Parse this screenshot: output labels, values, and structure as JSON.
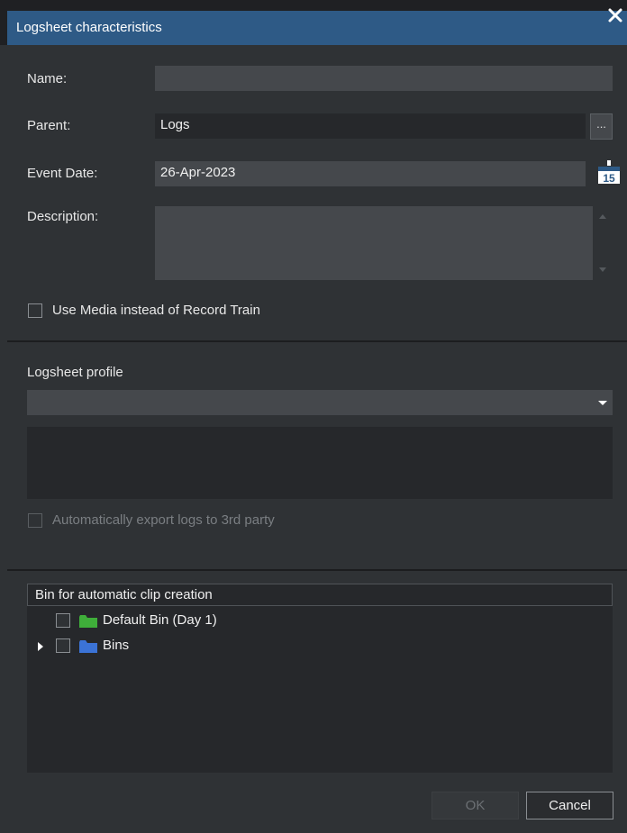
{
  "window": {
    "title": "Logsheet characteristics"
  },
  "form": {
    "name_label": "Name:",
    "name_value": "",
    "parent_label": "Parent:",
    "parent_value": "Logs",
    "browse_label": "...",
    "event_date_label": "Event Date:",
    "event_date_value": "26-Apr-2023",
    "calendar_day": "15",
    "description_label": "Description:",
    "description_value": "",
    "use_media_label": "Use Media instead of Record Train",
    "use_media_checked": false
  },
  "profile": {
    "section_label": "Logsheet profile",
    "selected": "",
    "auto_export_label": "Automatically export logs to 3rd party",
    "auto_export_checked": false,
    "auto_export_enabled": false
  },
  "bins": {
    "header": "Bin for automatic clip creation",
    "items": [
      {
        "label": "Default Bin (Day 1)",
        "checked": false,
        "folder_color": "#3fae3a",
        "expandable": false
      },
      {
        "label": "Bins",
        "checked": false,
        "folder_color": "#3b73d6",
        "expandable": true
      }
    ]
  },
  "buttons": {
    "ok": "OK",
    "cancel": "Cancel"
  },
  "colors": {
    "title_bar": "#2e5a86",
    "background": "#2f3235"
  }
}
